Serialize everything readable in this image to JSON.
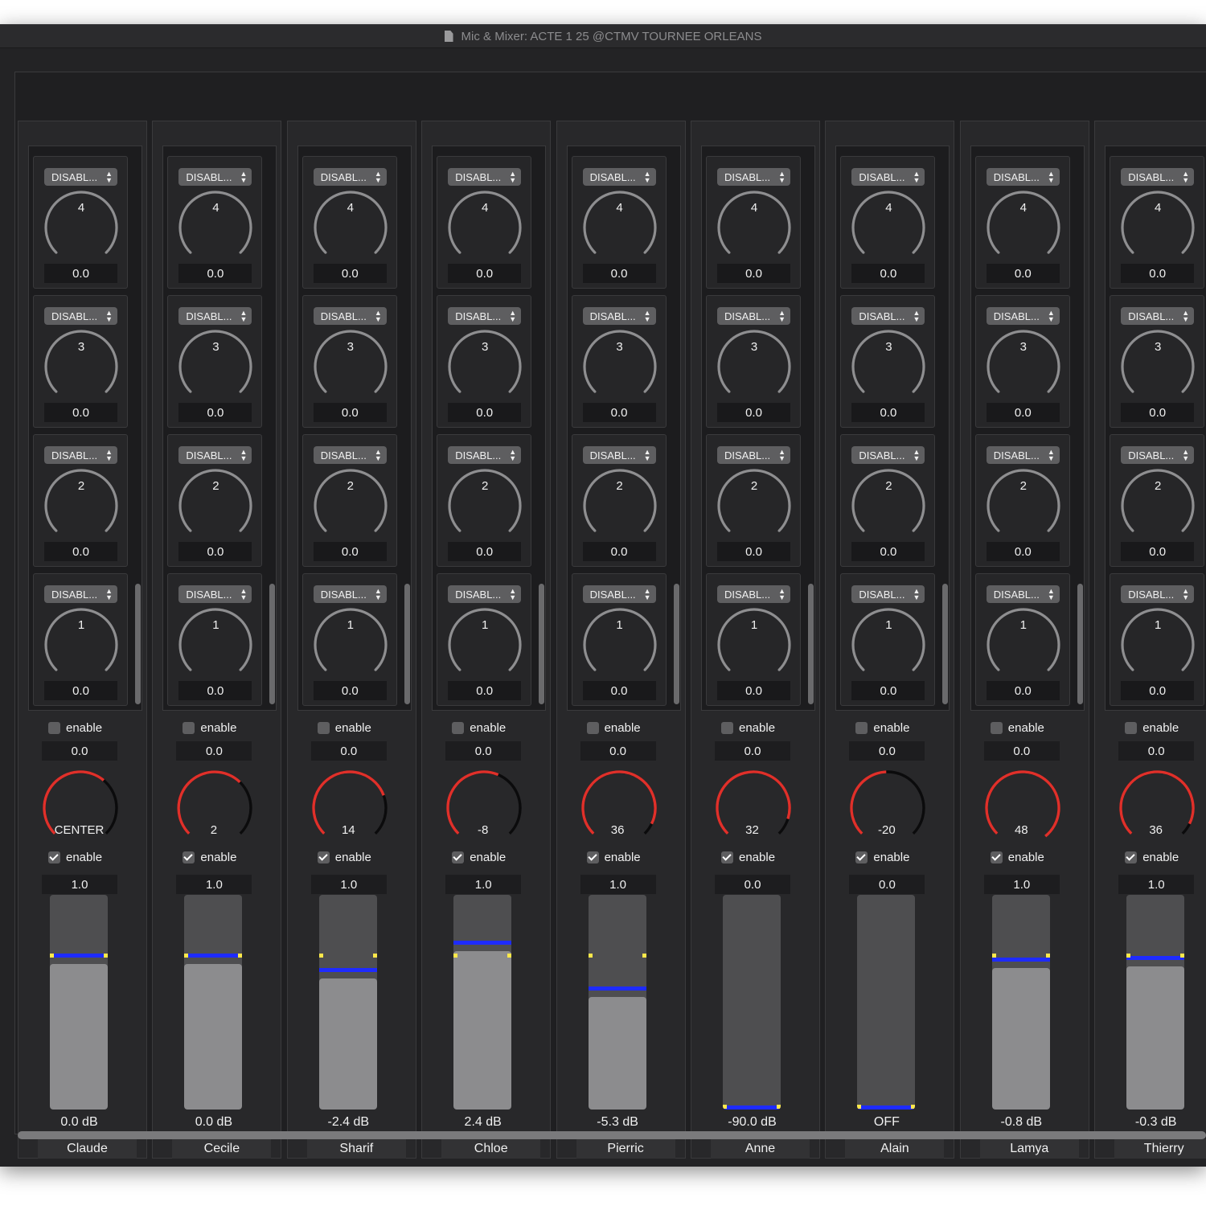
{
  "window": {
    "title": "Mic & Mixer: ACTE 1 25 @CTMV TOURNEE ORLEANS",
    "title_icon": "document-icon"
  },
  "colors": {
    "pan_arc": "#e0302a",
    "fader_level_line": "#1e2bff",
    "fader_marker": "#ffe84a",
    "background": "#232325"
  },
  "insert_slot_labels": [
    "4",
    "3",
    "2",
    "1"
  ],
  "channels": [
    {
      "name": "Claude",
      "inserts": [
        {
          "select": "DISABL...",
          "value": "0.0"
        },
        {
          "select": "DISABL...",
          "value": "0.0"
        },
        {
          "select": "DISABL...",
          "value": "0.0"
        },
        {
          "select": "DISABL...",
          "value": "0.0"
        }
      ],
      "sends_enable": {
        "label": "enable",
        "checked": false
      },
      "sends_value": "0.0",
      "pan_label": "CENTER",
      "pan_value": 0,
      "gain_enable": {
        "label": "enable",
        "checked": true
      },
      "gain_value": "1.0",
      "fader_level": 0.73,
      "fader_db": "0.0 dB"
    },
    {
      "name": "Cecile",
      "inserts": [
        {
          "select": "DISABL...",
          "value": "0.0"
        },
        {
          "select": "DISABL...",
          "value": "0.0"
        },
        {
          "select": "DISABL...",
          "value": "0.0"
        },
        {
          "select": "DISABL...",
          "value": "0.0"
        }
      ],
      "sends_enable": {
        "label": "enable",
        "checked": false
      },
      "sends_value": "0.0",
      "pan_label": "2",
      "pan_value": 2,
      "gain_enable": {
        "label": "enable",
        "checked": true
      },
      "gain_value": "1.0",
      "fader_level": 0.73,
      "fader_db": "0.0 dB"
    },
    {
      "name": "Sharif",
      "inserts": [
        {
          "select": "DISABL...",
          "value": "0.0"
        },
        {
          "select": "DISABL...",
          "value": "0.0"
        },
        {
          "select": "DISABL...",
          "value": "0.0"
        },
        {
          "select": "DISABL...",
          "value": "0.0"
        }
      ],
      "sends_enable": {
        "label": "enable",
        "checked": false
      },
      "sends_value": "0.0",
      "pan_label": "14",
      "pan_value": 14,
      "gain_enable": {
        "label": "enable",
        "checked": true
      },
      "gain_value": "1.0",
      "fader_level": 0.66,
      "fader_db": "-2.4 dB"
    },
    {
      "name": "Chloe",
      "inserts": [
        {
          "select": "DISABL...",
          "value": "0.0"
        },
        {
          "select": "DISABL...",
          "value": "0.0"
        },
        {
          "select": "DISABL...",
          "value": "0.0"
        },
        {
          "select": "DISABL...",
          "value": "0.0"
        }
      ],
      "sends_enable": {
        "label": "enable",
        "checked": false
      },
      "sends_value": "0.0",
      "pan_label": "-8",
      "pan_value": -8,
      "gain_enable": {
        "label": "enable",
        "checked": true
      },
      "gain_value": "1.0",
      "fader_level": 0.79,
      "fader_db": "2.4 dB"
    },
    {
      "name": "Pierric",
      "inserts": [
        {
          "select": "DISABL...",
          "value": "0.0"
        },
        {
          "select": "DISABL...",
          "value": "0.0"
        },
        {
          "select": "DISABL...",
          "value": "0.0"
        },
        {
          "select": "DISABL...",
          "value": "0.0"
        }
      ],
      "sends_enable": {
        "label": "enable",
        "checked": false
      },
      "sends_value": "0.0",
      "pan_label": "36",
      "pan_value": 36,
      "gain_enable": {
        "label": "enable",
        "checked": true
      },
      "gain_value": "1.0",
      "fader_level": 0.57,
      "fader_db": "-5.3 dB"
    },
    {
      "name": "Anne",
      "inserts": [
        {
          "select": "DISABL...",
          "value": "0.0"
        },
        {
          "select": "DISABL...",
          "value": "0.0"
        },
        {
          "select": "DISABL...",
          "value": "0.0"
        },
        {
          "select": "DISABL...",
          "value": "0.0"
        }
      ],
      "sends_enable": {
        "label": "enable",
        "checked": false
      },
      "sends_value": "0.0",
      "pan_label": "32",
      "pan_value": 32,
      "gain_enable": {
        "label": "enable",
        "checked": true
      },
      "gain_value": "0.0",
      "fader_level": 0.0,
      "fader_db": "-90.0 dB"
    },
    {
      "name": "Alain",
      "inserts": [
        {
          "select": "DISABL...",
          "value": "0.0"
        },
        {
          "select": "DISABL...",
          "value": "0.0"
        },
        {
          "select": "DISABL...",
          "value": "0.0"
        },
        {
          "select": "DISABL...",
          "value": "0.0"
        }
      ],
      "sends_enable": {
        "label": "enable",
        "checked": false
      },
      "sends_value": "0.0",
      "pan_label": "-20",
      "pan_value": -20,
      "gain_enable": {
        "label": "enable",
        "checked": true
      },
      "gain_value": "0.0",
      "fader_level": 0.0,
      "fader_db": "OFF"
    },
    {
      "name": "Lamya",
      "inserts": [
        {
          "select": "DISABL...",
          "value": "0.0"
        },
        {
          "select": "DISABL...",
          "value": "0.0"
        },
        {
          "select": "DISABL...",
          "value": "0.0"
        },
        {
          "select": "DISABL...",
          "value": "0.0"
        }
      ],
      "sends_enable": {
        "label": "enable",
        "checked": false
      },
      "sends_value": "0.0",
      "pan_label": "48",
      "pan_value": 48,
      "gain_enable": {
        "label": "enable",
        "checked": true
      },
      "gain_value": "1.0",
      "fader_level": 0.71,
      "fader_db": "-0.8 dB"
    },
    {
      "name": "Thierry",
      "inserts": [
        {
          "select": "DISABL...",
          "value": "0.0"
        },
        {
          "select": "DISABL...",
          "value": "0.0"
        },
        {
          "select": "DISABL...",
          "value": "0.0"
        },
        {
          "select": "DISABL...",
          "value": "0.0"
        }
      ],
      "sends_enable": {
        "label": "enable",
        "checked": false
      },
      "sends_value": "0.0",
      "pan_label": "36",
      "pan_value": 36,
      "gain_enable": {
        "label": "enable",
        "checked": true
      },
      "gain_value": "1.0",
      "fader_level": 0.72,
      "fader_db": "-0.3 dB"
    }
  ]
}
